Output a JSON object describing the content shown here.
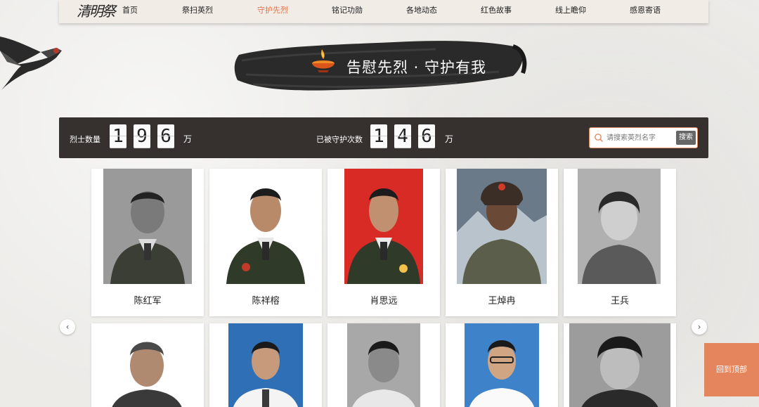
{
  "nav": {
    "items": [
      {
        "label": "首页",
        "active": false
      },
      {
        "label": "祭扫英烈",
        "active": false
      },
      {
        "label": "守护先烈",
        "active": true
      },
      {
        "label": "铭记功勋",
        "active": false
      },
      {
        "label": "各地动态",
        "active": false
      },
      {
        "label": "红色故事",
        "active": false
      },
      {
        "label": "线上瞻仰",
        "active": false
      },
      {
        "label": "感恩寄语",
        "active": false
      }
    ]
  },
  "banner": {
    "title": "告慰先烈 · 守护有我"
  },
  "stats": {
    "martyrs_label": "烈士数量",
    "martyrs_digits": [
      "1",
      "9",
      "6"
    ],
    "martyrs_unit": "万",
    "guard_label": "已被守护次数",
    "guard_digits": [
      "1",
      "4",
      "6"
    ],
    "guard_unit": "万"
  },
  "search": {
    "placeholder": "请搜索英烈名字",
    "button_label": "搜索"
  },
  "martyrs_row1": [
    {
      "name": "陈红军",
      "photo_bg": "#9a9a9a"
    },
    {
      "name": "陈祥榕",
      "photo_bg": "#ffffff"
    },
    {
      "name": "肖思远",
      "photo_bg": "#d92b25"
    },
    {
      "name": "王焯冉",
      "photo_bg": "#6a7a88"
    },
    {
      "name": "王兵",
      "photo_bg": "#b0b0b0"
    }
  ],
  "martyrs_row2": [
    {
      "photo_bg": "#ffffff"
    },
    {
      "photo_bg": "#2e6fb6"
    },
    {
      "photo_bg": "#a8a8a8"
    },
    {
      "photo_bg": "#3e82c9"
    },
    {
      "photo_bg": "#9c9c9c"
    }
  ],
  "back_to_top": "回到顶部",
  "colors": {
    "accent": "#e2734a",
    "stats_bg": "#36312e",
    "back_top_bg": "#e4855e"
  }
}
